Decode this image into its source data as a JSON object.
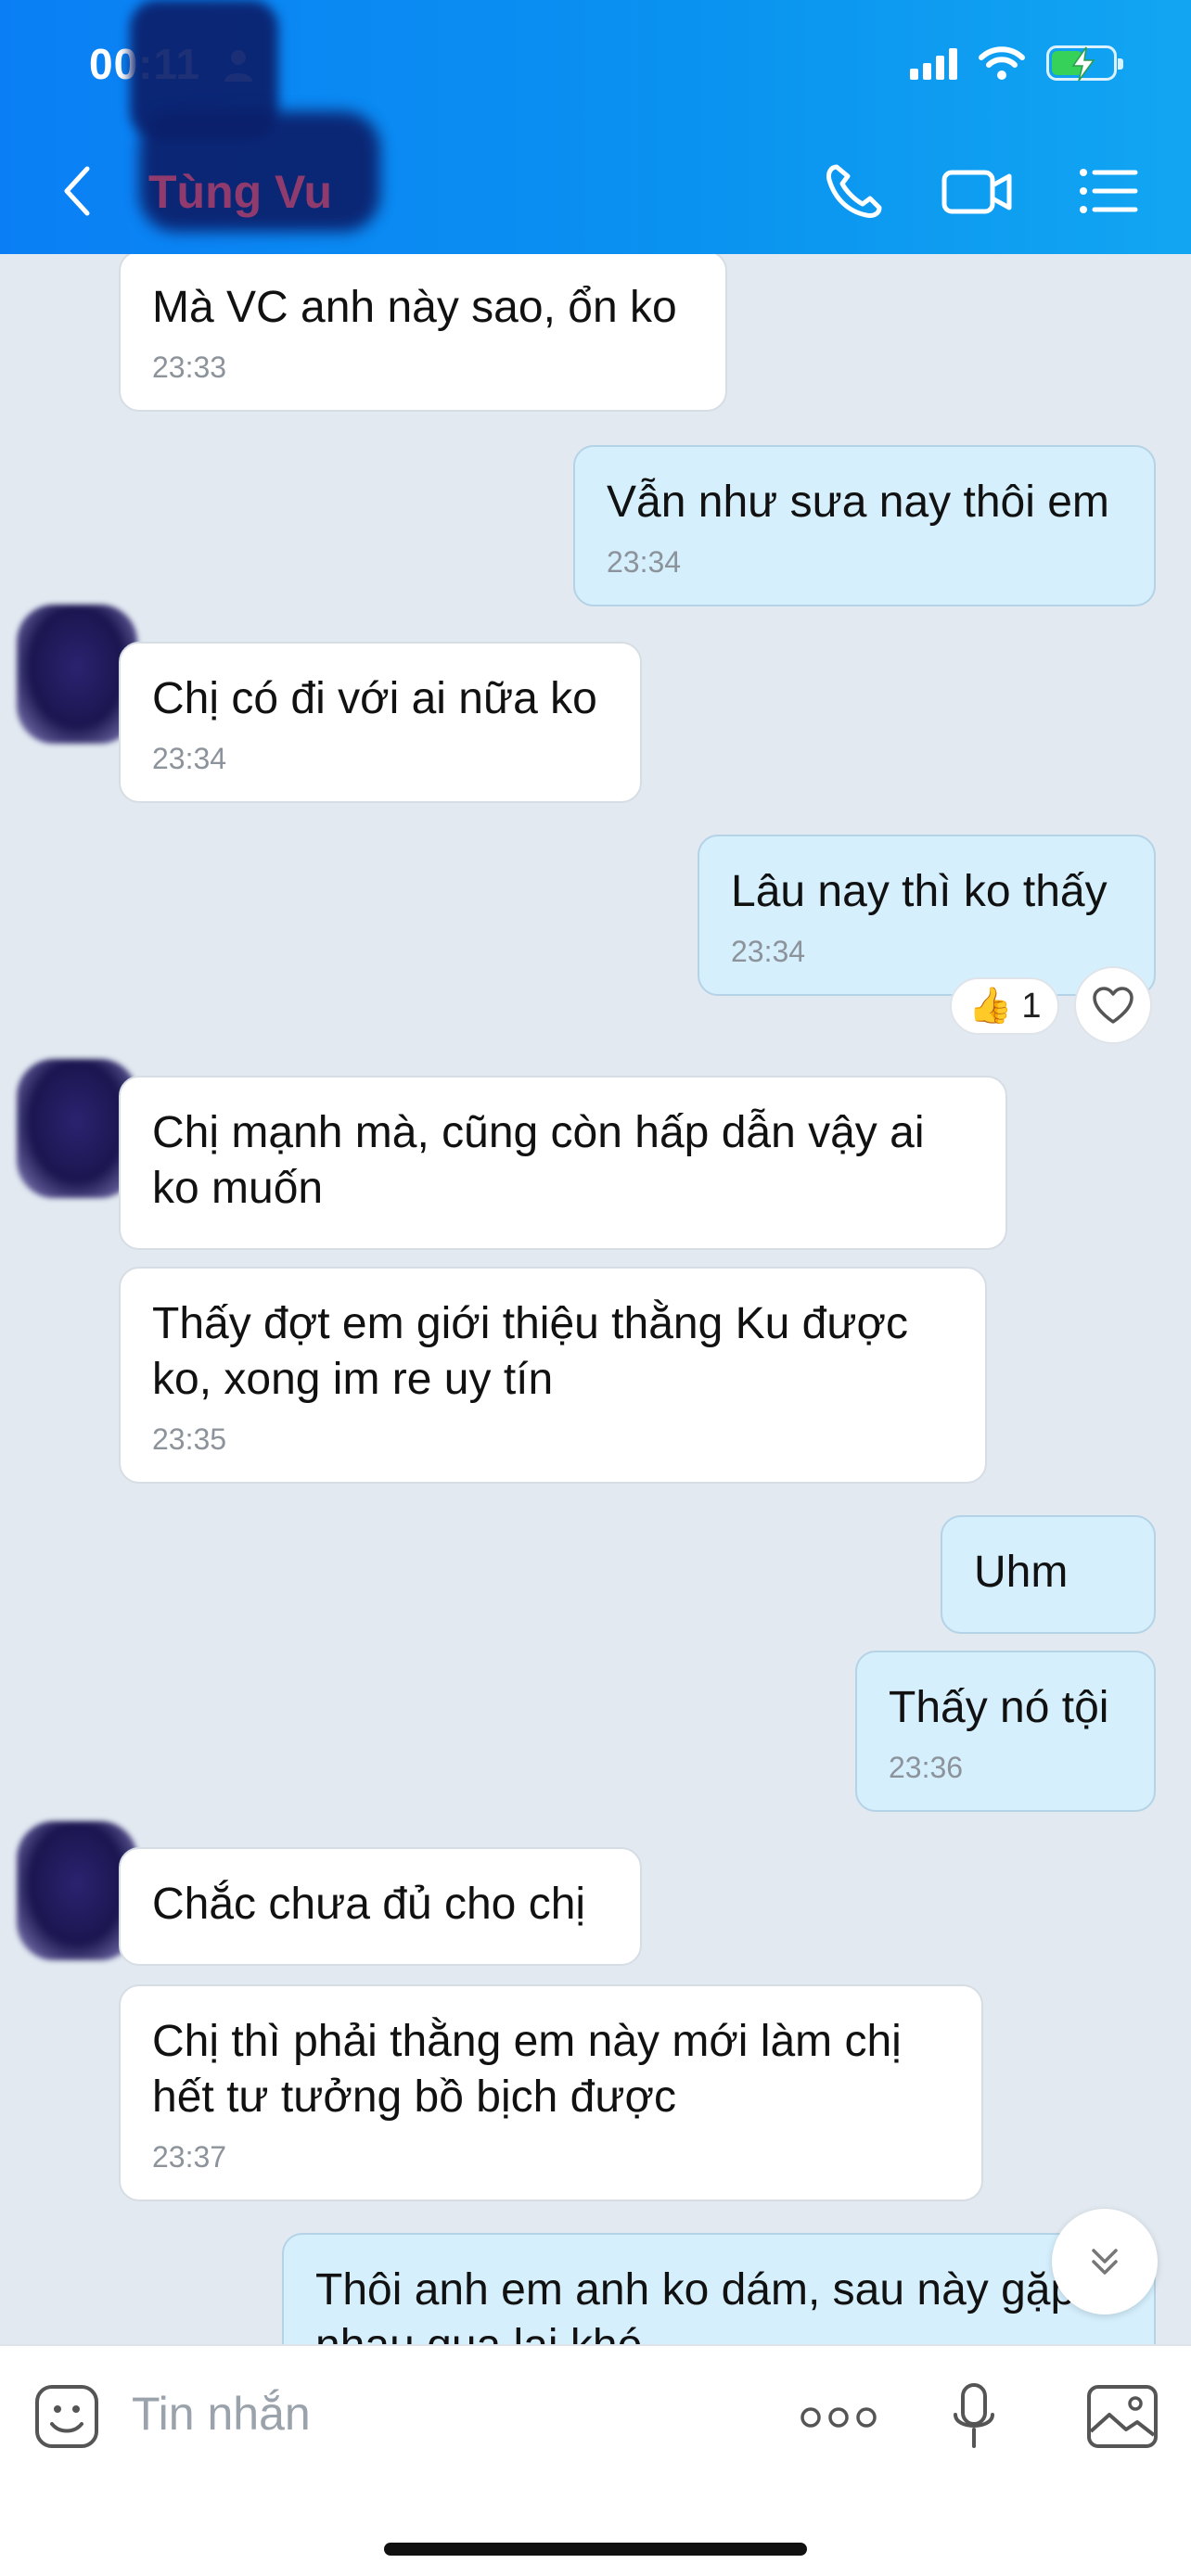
{
  "status_bar": {
    "time": "00:11",
    "battery_level": 0.52
  },
  "header": {
    "contact_name": "Tùng Vu"
  },
  "messages": [
    {
      "text": "Mà VC anh này sao, ổn ko",
      "time": "23:33",
      "direction": "in"
    },
    {
      "text": "Vẫn như sưa nay thôi em",
      "time": "23:34",
      "direction": "out"
    },
    {
      "text": "Chị có đi với ai nữa ko",
      "time": "23:34",
      "direction": "in"
    },
    {
      "text": "Lâu nay thì ko thấy",
      "time": "23:34",
      "direction": "out",
      "reaction": {
        "emoji": "👍",
        "count": "1"
      }
    },
    {
      "text": "Chị mạnh mà, cũng còn hấp dẫn vậy ai ko muốn",
      "time": "",
      "direction": "in"
    },
    {
      "text": "Thấy đợt em giới thiệu thằng Ku được ko, xong im re uy tín",
      "time": "23:35",
      "direction": "in"
    },
    {
      "text": "Uhm",
      "time": "",
      "direction": "out"
    },
    {
      "text": "Thấy nó tội",
      "time": "23:36",
      "direction": "out"
    },
    {
      "text": "Chắc chưa đủ cho chị",
      "time": "",
      "direction": "in"
    },
    {
      "text": "Chị thì phải thằng em này mới làm chị hết tư tưởng bồ bịch được",
      "time": "23:37",
      "direction": "in"
    },
    {
      "text": "Thôi anh em anh ko dám, sau này gặp nhau qua lại khó",
      "time": "",
      "direction": "out"
    }
  ],
  "input": {
    "placeholder": "Tin nhắn"
  },
  "icons": {
    "back": "chevron-left-icon",
    "call": "phone-icon",
    "video": "video-camera-icon",
    "menu": "list-menu-icon",
    "sticker": "sticker-face-icon",
    "more": "more-dots-icon",
    "mic": "microphone-icon",
    "image": "image-icon",
    "heart": "heart-icon",
    "scroll_down": "double-chevron-down-icon"
  },
  "colors": {
    "header": "#0a7ff5",
    "incoming_bubble": "#ffffff",
    "outgoing_bubble": "#d5effd",
    "chat_background": "#e2e9f1"
  }
}
